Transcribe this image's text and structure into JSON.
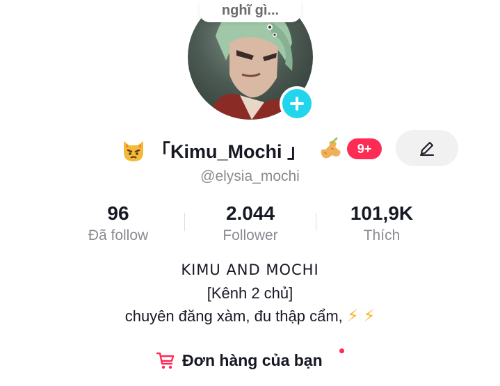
{
  "note": {
    "text": "nghĩ gì..."
  },
  "profile": {
    "display_name": "「Kimu_Mochi 」",
    "username": "@elysia_mochi",
    "notification_badge": "9+",
    "accent_color": "#fe2c55",
    "plus_color": "#20d5ec"
  },
  "stats": [
    {
      "value": "96",
      "label": "Đã follow"
    },
    {
      "value": "2.044",
      "label": "Follower"
    },
    {
      "value": "101,9K",
      "label": "Thích"
    }
  ],
  "bio": {
    "line1": "KIMU AND MOCHI",
    "line2": "[Kênh 2 chủ]",
    "line3": "chuyên đăng xàm, đu thập cẩm,",
    "line3_emoji": "⚡ ⚡"
  },
  "orders": {
    "label": "Đơn hàng của bạn"
  },
  "icons": {
    "cat_emoji": "pouting-cat-icon",
    "ginger_emoji": "ginger-icon",
    "edit": "pencil-icon",
    "cart": "cart-icon",
    "add": "plus-icon"
  }
}
